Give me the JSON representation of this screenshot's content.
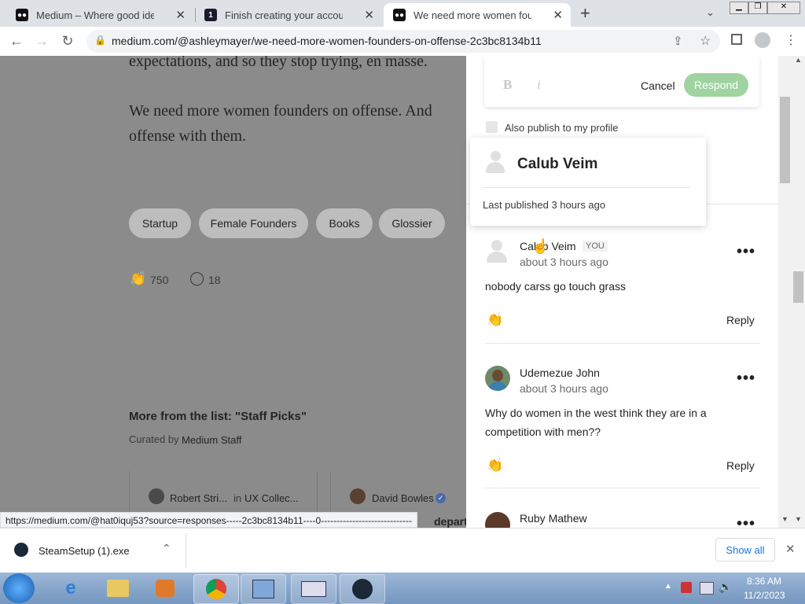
{
  "tabs": [
    {
      "title": "Medium – Where good ideas find you",
      "icon": "medium-logo-icon"
    },
    {
      "title": "Finish creating your account on Medium",
      "icon": "badge-1-icon",
      "badge": "1"
    },
    {
      "title": "We need more women founders on offense",
      "icon": "medium-logo-icon"
    }
  ],
  "new_tab_label": "+",
  "toolbar": {
    "url": "medium.com/@ashleymayer/we-need-more-women-founders-on-offense-2c3bc8134b11"
  },
  "article": {
    "line1": "expectations, and so they stop trying, en masse.",
    "line2": "We need more women founders on offense. And",
    "line3": "offense with them.",
    "tags": [
      "Startup",
      "Female Founders",
      "Books",
      "Glossier"
    ],
    "claps": "750",
    "responses": "18",
    "list_heading": "More from the list: \"Staff Picks\"",
    "curated_by": "Curated by",
    "curator": "Medium Staff",
    "card1_author": "Robert Stri...",
    "card1_in": "in",
    "card1_pub": "UX Collec...",
    "card2_author": "David Bowles",
    "card2_partial": "depart"
  },
  "status_url": "https://medium.com/@hat0iquj53?source=responses-----2c3bc8134b11----0-----------------------------",
  "editor": {
    "bold": "B",
    "italic": "i",
    "cancel": "Cancel",
    "respond": "Respond",
    "publish_label": "Also publish to my profile"
  },
  "popup": {
    "name": "Calub Veim",
    "last_published": "Last published 3 hours ago"
  },
  "comments": [
    {
      "name": "Calub Veim",
      "you": "YOU",
      "time": "about 3 hours ago",
      "text": "nobody carss go touch grass",
      "reply": "Reply",
      "more": "•••"
    },
    {
      "name": "Udemezue John",
      "time": "about 3 hours ago",
      "text_line1": "Why do women in the west think they are in a",
      "text_line2": "competition with men??",
      "reply": "Reply",
      "more": "•••"
    },
    {
      "name": "Ruby Mathew",
      "more": "•••"
    }
  ],
  "downloads": {
    "file": "SteamSetup (1).exe",
    "show_all": "Show all"
  },
  "taskbar": {
    "time": "8:36 AM",
    "date": "11/2/2023"
  },
  "colors": {
    "respond_green": "#9fd3a0",
    "tab_strip": "#dee1e6",
    "article_overlay": "#8b8b8b"
  }
}
